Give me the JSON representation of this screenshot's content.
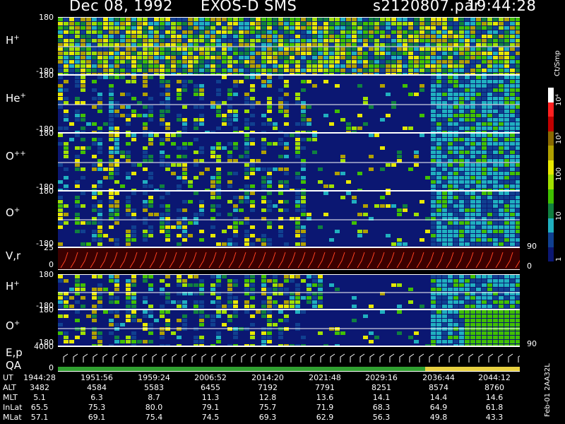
{
  "header": {
    "date": "Dec 08, 1992",
    "instrument": "EXOS-D SMS",
    "file": "s2120807.par",
    "time": "19:44:28"
  },
  "panels": [
    {
      "id": "hplus1",
      "label": "H",
      "sup": "+",
      "ticks": [
        "180",
        "-180"
      ]
    },
    {
      "id": "heplus",
      "label": "He",
      "sup": "+",
      "ticks": [
        "180",
        "-180"
      ]
    },
    {
      "id": "oplusplus",
      "label": "O",
      "sup": "++",
      "ticks": [
        "180",
        "-180"
      ]
    },
    {
      "id": "oplus1",
      "label": "O",
      "sup": "+",
      "ticks": [
        "180",
        "-180"
      ]
    },
    {
      "id": "vr",
      "label": "V,r",
      "sup": "",
      "ticks": [
        "25",
        "0"
      ],
      "rticks": [
        "90",
        "0"
      ]
    },
    {
      "id": "hplus2",
      "label": "H",
      "sup": "+",
      "ticks": [
        "180",
        "-180"
      ]
    },
    {
      "id": "oplus2",
      "label": "O",
      "sup": "+",
      "ticks": [
        "180",
        "-180"
      ],
      "rticks": [
        "90"
      ]
    },
    {
      "id": "ep",
      "label": "E,p",
      "sub": "QA",
      "ticks": [
        "4000",
        "0"
      ]
    }
  ],
  "colorbar": {
    "unit": "Ct/Smp",
    "labels": [
      "10⁴",
      "10³",
      "100",
      "10",
      "1"
    ],
    "colors": [
      "#ffffff",
      "#ff2020",
      "#c00000",
      "#8a6a00",
      "#b0a000",
      "#e8e800",
      "#a0e000",
      "#40c000",
      "#108040",
      "#20b0c0",
      "#104090",
      "#0b1772"
    ]
  },
  "time_table": {
    "rows": [
      {
        "name": "UT",
        "values": [
          "1944:28",
          "1951:56",
          "1959:24",
          "2006:52",
          "2014:20",
          "2021:48",
          "2029:16",
          "2036:44",
          "2044:12"
        ]
      },
      {
        "name": "ALT",
        "values": [
          "3482",
          "4584",
          "5583",
          "6455",
          "7192",
          "7791",
          "8251",
          "8574",
          "8760"
        ]
      },
      {
        "name": "MLT",
        "values": [
          "5.1",
          "6.3",
          "8.7",
          "11.3",
          "12.8",
          "13.6",
          "14.1",
          "14.4",
          "14.6"
        ]
      },
      {
        "name": "InLat",
        "values": [
          "65.5",
          "75.3",
          "80.0",
          "79.1",
          "75.7",
          "71.9",
          "68.3",
          "64.9",
          "61.8"
        ]
      },
      {
        "name": "MLat",
        "values": [
          "57.1",
          "69.1",
          "75.4",
          "74.5",
          "69.3",
          "62.9",
          "56.3",
          "49.8",
          "43.3"
        ]
      }
    ]
  },
  "side_label": "Feb-01 2AA32L"
}
